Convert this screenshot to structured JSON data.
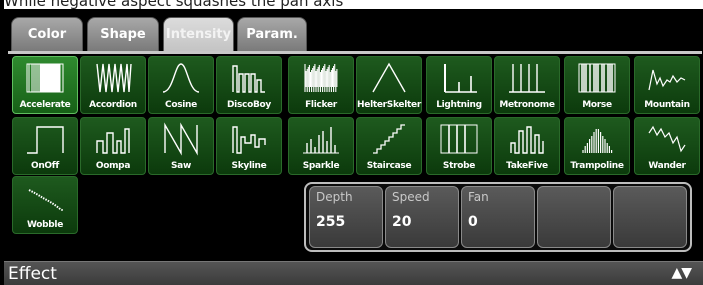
{
  "caption": "While negative aspect squashes the pan axis",
  "tabs": [
    {
      "label": "Color"
    },
    {
      "label": "Shape"
    },
    {
      "label": "Intensity"
    },
    {
      "label": "Param."
    }
  ],
  "effects": [
    {
      "label": "Accelerate",
      "icon": "accelerate-icon",
      "selected": true
    },
    {
      "label": "Accordion",
      "icon": "accordion-icon"
    },
    {
      "label": "Cosine",
      "icon": "cosine-icon"
    },
    {
      "label": "DiscoBoy",
      "icon": "discoboy-icon"
    },
    {
      "label": "Flicker",
      "icon": "flicker-icon"
    },
    {
      "label": "HelterSkelter",
      "icon": "helterskelter-icon"
    },
    {
      "label": "Lightning",
      "icon": "lightning-icon"
    },
    {
      "label": "Metronome",
      "icon": "metronome-icon"
    },
    {
      "label": "Morse",
      "icon": "morse-icon"
    },
    {
      "label": "Mountain",
      "icon": "mountain-icon"
    },
    {
      "label": "OnOff",
      "icon": "onoff-icon"
    },
    {
      "label": "Oompa",
      "icon": "oompa-icon"
    },
    {
      "label": "Saw",
      "icon": "saw-icon"
    },
    {
      "label": "Skyline",
      "icon": "skyline-icon"
    },
    {
      "label": "Sparkle",
      "icon": "sparkle-icon"
    },
    {
      "label": "Staircase",
      "icon": "staircase-icon"
    },
    {
      "label": "Strobe",
      "icon": "strobe-icon"
    },
    {
      "label": "TakeFive",
      "icon": "takefive-icon"
    },
    {
      "label": "Trampoline",
      "icon": "trampoline-icon"
    },
    {
      "label": "Wander",
      "icon": "wander-icon"
    },
    {
      "label": "Wobble",
      "icon": "wobble-icon"
    }
  ],
  "params": [
    {
      "label": "Depth",
      "value": "255"
    },
    {
      "label": "Speed",
      "value": "20"
    },
    {
      "label": "Fan",
      "value": "0"
    },
    {
      "label": "",
      "value": ""
    },
    {
      "label": "",
      "value": ""
    }
  ],
  "footer": {
    "title": "Effect",
    "arrows": "▲▼"
  }
}
